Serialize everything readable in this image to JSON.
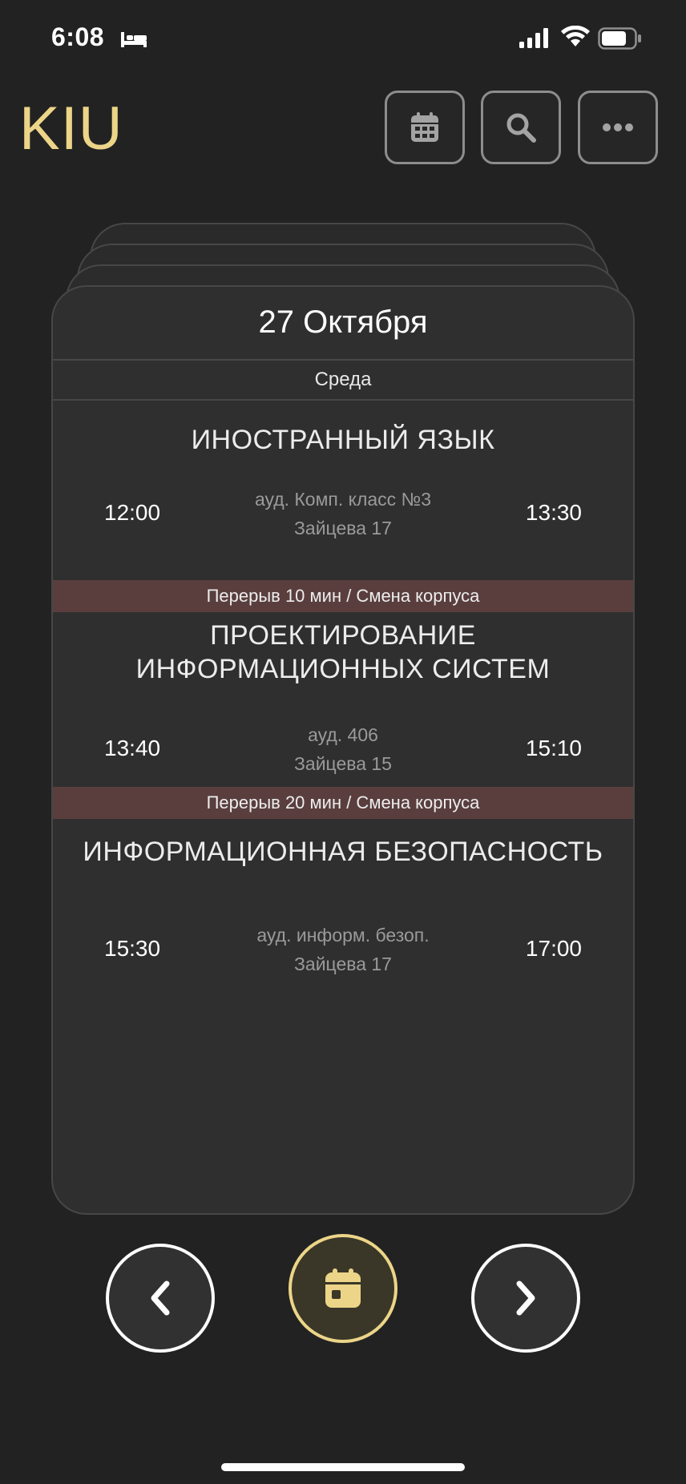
{
  "status_bar": {
    "time": "6:08"
  },
  "header": {
    "brand": "KIU",
    "buttons": [
      "calendar-icon",
      "search-icon",
      "more-icon"
    ]
  },
  "day": {
    "date": "27 Октября",
    "weekday": "Среда"
  },
  "lessons": [
    {
      "title_lines": [
        "ИНОСТРАННЫЙ ЯЗЫК"
      ],
      "start": "12:00",
      "end": "13:30",
      "room": "ауд. Комп. класс №3",
      "building": "Зайцева 17"
    },
    {
      "title_lines": [
        "ПРОЕКТИРОВАНИЕ",
        "ИНФОРМАЦИОННЫХ СИСТЕМ"
      ],
      "start": "13:40",
      "end": "15:10",
      "room": "ауд. 406",
      "building": "Зайцева 15"
    },
    {
      "title_lines": [
        "ИНФОРМАЦИОННАЯ БЕЗОПАСНОСТЬ"
      ],
      "start": "15:30",
      "end": "17:00",
      "room": "ауд. информ. безоп.",
      "building": "Зайцева 17"
    }
  ],
  "breaks": [
    "Перерыв 10 мин / Смена корпуса",
    "Перерыв 20 мин / Смена корпуса"
  ],
  "colors": {
    "accent": "#ecd588",
    "background": "#222222",
    "card": "#2f2f2f",
    "break": "#5a3e3e"
  },
  "nav": {
    "prev_icon": "chevron-left-icon",
    "today_icon": "calendar-today-icon",
    "next_icon": "chevron-right-icon"
  }
}
